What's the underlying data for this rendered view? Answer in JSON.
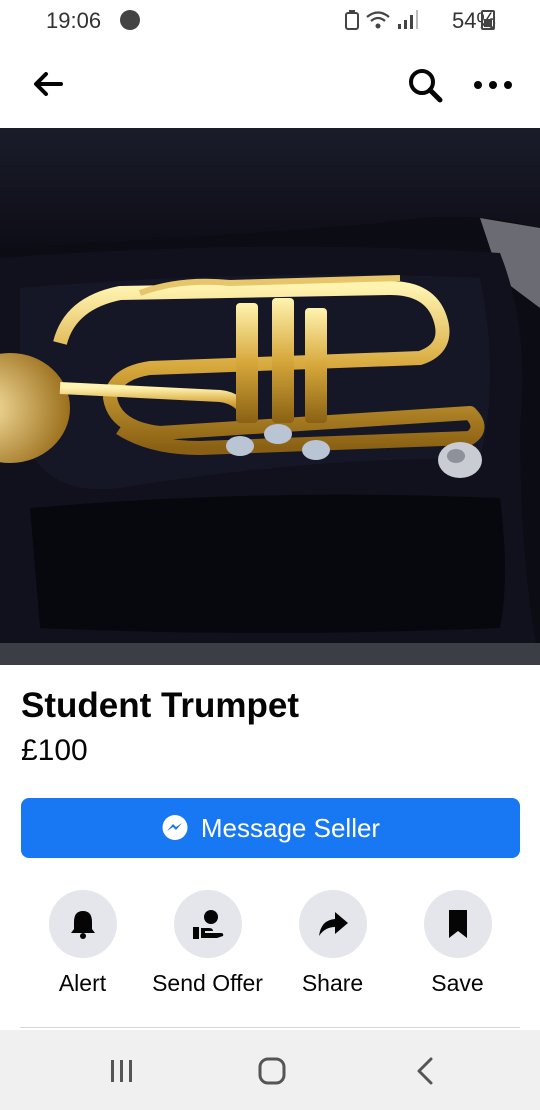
{
  "status_bar": {
    "time": "19:06",
    "battery": "54%"
  },
  "app_bar": {
    "back_icon": "arrow-left-icon",
    "search_icon": "search-icon",
    "more_icon": "more-horizontal-icon"
  },
  "listing": {
    "title": "Student Trumpet",
    "price": "£100"
  },
  "message_button": {
    "label": "Message Seller",
    "icon": "messenger-icon",
    "color": "#1877f2"
  },
  "actions": [
    {
      "label": "Alert",
      "icon": "bell-icon"
    },
    {
      "label": "Send Offer",
      "icon": "offer-hand-icon"
    },
    {
      "label": "Share",
      "icon": "share-arrow-icon"
    },
    {
      "label": "Save",
      "icon": "bookmark-icon"
    }
  ],
  "nav_bar": {
    "recents_icon": "recents-icon",
    "home_icon": "home-icon",
    "back_icon": "nav-back-icon"
  }
}
